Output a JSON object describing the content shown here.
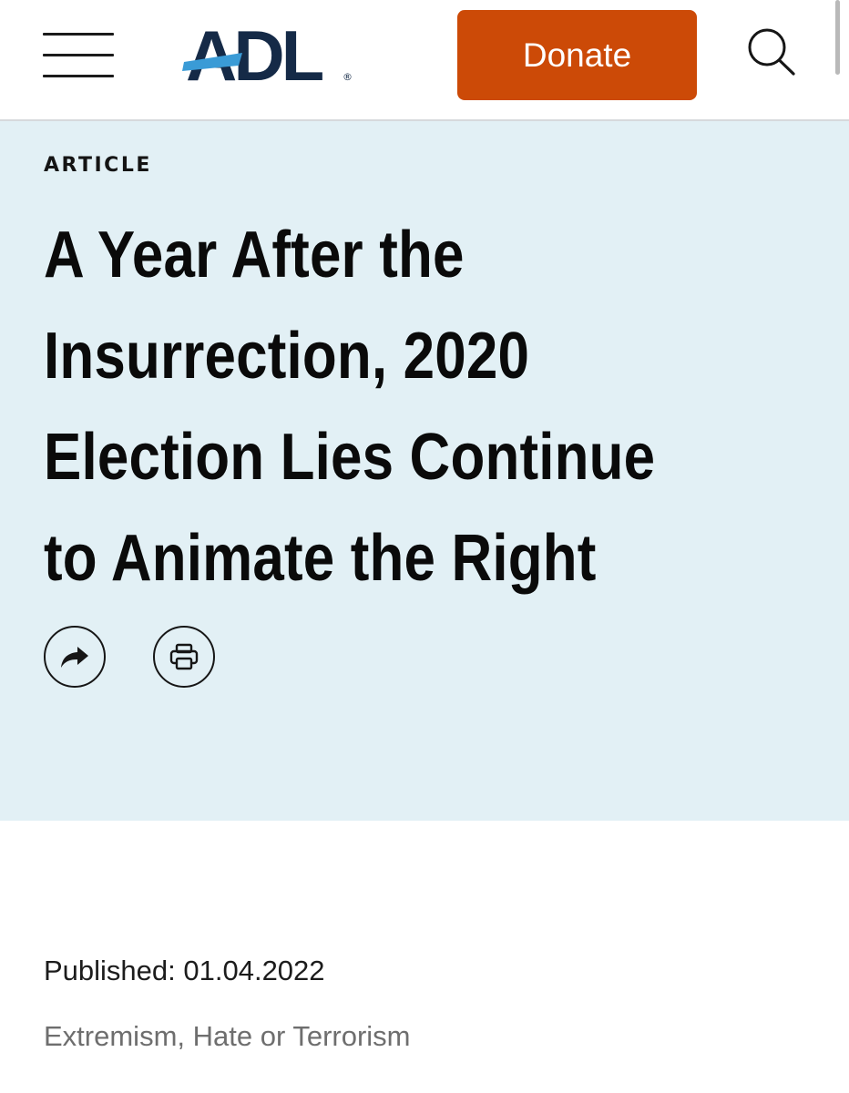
{
  "header": {
    "logo_text": "ADL",
    "logo_mark": "®",
    "donate_label": "Donate",
    "menu_icon": "hamburger-menu-icon",
    "search_icon": "search-icon"
  },
  "hero": {
    "eyebrow": "ARTICLE",
    "title_lines": [
      "A Year After the",
      "Insurrection, 2020",
      "Election Lies Continue",
      "to Animate the Right"
    ],
    "share_icon": "share-arrow-icon",
    "print_icon": "printer-icon"
  },
  "meta": {
    "published": "Published: 01.04.2022",
    "topics": [
      "Extremism",
      "Hate or Terrorism"
    ],
    "topic_separator": ", "
  },
  "colors": {
    "donate_bg": "#cc4a07",
    "hero_bg": "#e2f0f5",
    "logo_navy": "#152a47",
    "logo_blue": "#3a9bd6",
    "topics_text": "#6e6e6e"
  }
}
